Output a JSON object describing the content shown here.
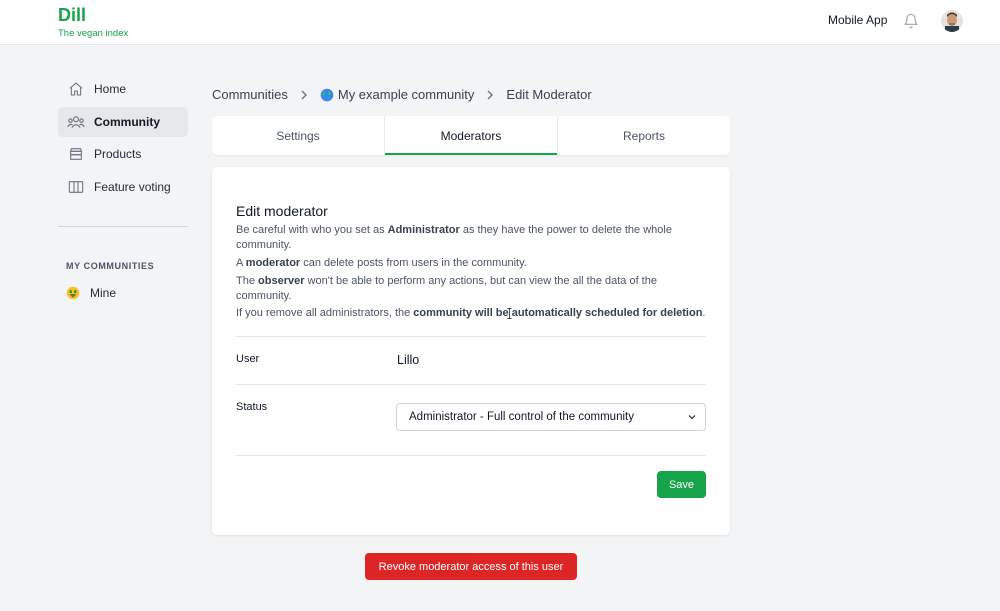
{
  "brand": {
    "title": "Dill",
    "subtitle": "The vegan index",
    "color": "#16a34a"
  },
  "header": {
    "mobile_app": "Mobile App",
    "notification_icon": "bell-icon",
    "avatar_icon": "user-avatar"
  },
  "sidebar": {
    "items": [
      {
        "label": "Home",
        "icon": "home-icon",
        "active": false
      },
      {
        "label": "Community",
        "icon": "users-icon",
        "active": true
      },
      {
        "label": "Products",
        "icon": "box-icon",
        "active": false
      },
      {
        "label": "Feature voting",
        "icon": "columns-icon",
        "active": false
      }
    ],
    "communities_heading": "MY COMMUNITIES",
    "communities": [
      {
        "label": "Mine",
        "icon": "money-face-emoji"
      }
    ]
  },
  "breadcrumb": {
    "root": "Communities",
    "community": "My example community",
    "community_icon": "globe-icon",
    "current": "Edit Moderator"
  },
  "tabs": [
    {
      "label": "Settings",
      "active": false
    },
    {
      "label": "Moderators",
      "active": true
    },
    {
      "label": "Reports",
      "active": false
    }
  ],
  "form": {
    "title": "Edit moderator",
    "desc": {
      "l1_a": "Be careful with who you set as ",
      "l1_b": "Administrator",
      "l1_c": " as they have the power to delete the whole",
      "l1_d": "community.",
      "l2_a": "A ",
      "l2_b": "moderator",
      "l2_c": " can delete posts from users in the community.",
      "l3_a": "The ",
      "l3_b": "observer",
      "l3_c": " won't be able to perform any actions, but can view the all the data of the",
      "l3_d": "community.",
      "l4_a": "If you remove all administrators, the ",
      "l4_b": "community will be automatically scheduled for deletion",
      "l4_c": "."
    },
    "user_label": "User",
    "user_value": "Lillo",
    "status_label": "Status",
    "status_value": "Administrator - Full control of the community",
    "save_label": "Save"
  },
  "revoke_label": "Revoke moderator access of this user",
  "colors": {
    "accent": "#16a34a",
    "danger": "#dc2626"
  }
}
